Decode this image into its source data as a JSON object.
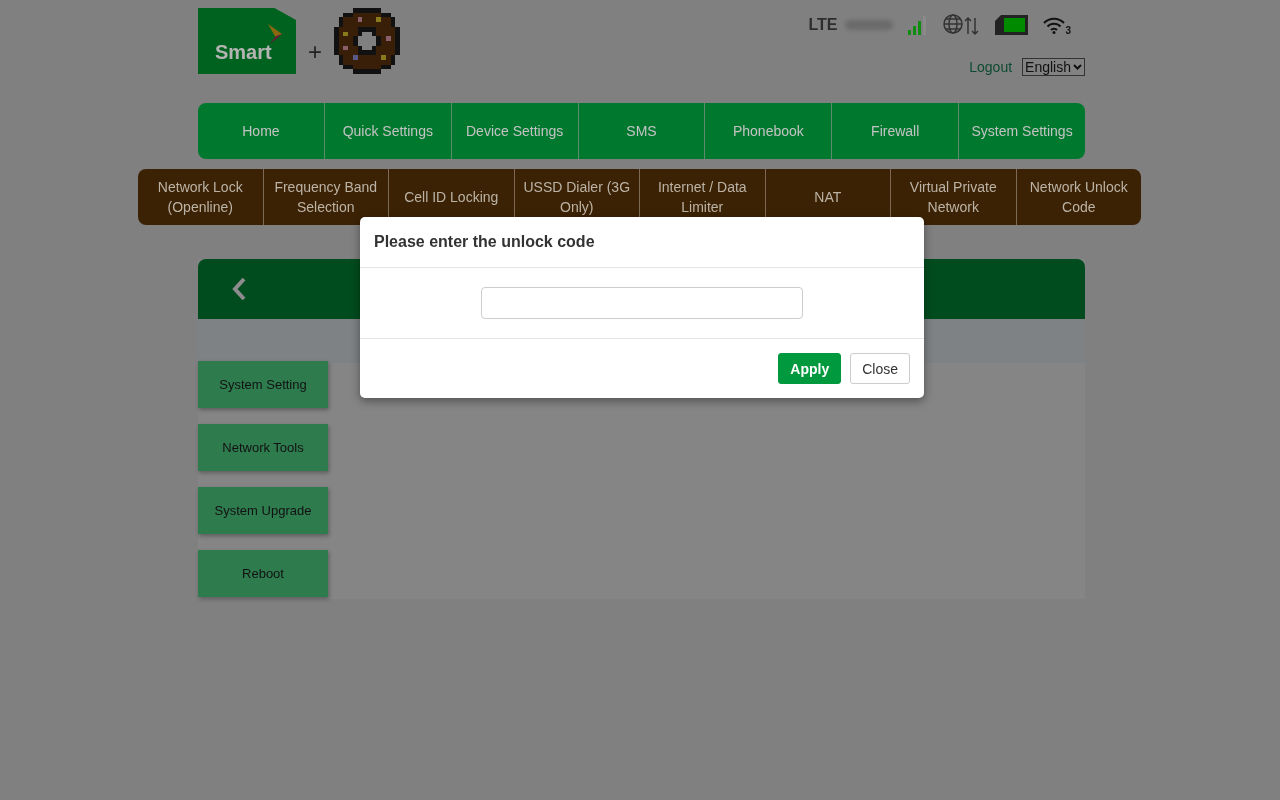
{
  "header": {
    "logo_text": "Smart",
    "plus": "+",
    "network_type": "LTE",
    "wifi_clients": "3",
    "logout": "Logout",
    "language": "English"
  },
  "main_nav": [
    {
      "label": "Home"
    },
    {
      "label": "Quick Settings"
    },
    {
      "label": "Device Settings"
    },
    {
      "label": "SMS"
    },
    {
      "label": "Phonebook"
    },
    {
      "label": "Firewall"
    },
    {
      "label": "System Settings"
    }
  ],
  "sub_nav": [
    {
      "label": "Network Lock (Openline)"
    },
    {
      "label": "Frequency Band Selection"
    },
    {
      "label": "Cell ID Locking"
    },
    {
      "label": "USSD Dialer (3G Only)"
    },
    {
      "label": "Internet / Data Limiter"
    },
    {
      "label": "NAT"
    },
    {
      "label": "Virtual Private Network"
    },
    {
      "label": "Network Unlock Code"
    }
  ],
  "side_menu": [
    {
      "label": "System Setting"
    },
    {
      "label": "Network Tools"
    },
    {
      "label": "System Upgrade"
    },
    {
      "label": "Reboot"
    }
  ],
  "dialog": {
    "title": "Please enter the unlock code",
    "buttons": [
      {
        "label": "Apply",
        "kind": "primary"
      },
      {
        "label": "Close",
        "kind": "secondary"
      }
    ]
  }
}
